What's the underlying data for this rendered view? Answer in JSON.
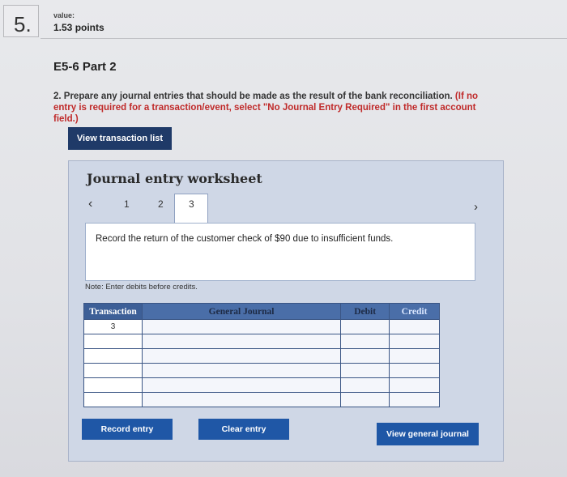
{
  "question": {
    "number": "5.",
    "value_label": "value:",
    "points": "1.53 points"
  },
  "part_title": "E5-6 Part 2",
  "instructions": {
    "main": "2. Prepare any journal entries that should be made as the result of the bank reconciliation.",
    "note_red": "(If no entry is required for a transaction/event, select \"No Journal Entry Required\" in the first account field.)"
  },
  "view_transaction_button": "View transaction list",
  "worksheet": {
    "title": "Journal entry worksheet",
    "nav": {
      "prev_icon": "chevron-left-icon",
      "next_icon": "chevron-right-icon",
      "tabs": [
        "1",
        "2",
        "3"
      ],
      "active_tab": "3"
    },
    "prompt": "Record the return of the customer check of $90 due to insufficient funds.",
    "note": "Note: Enter debits before credits.",
    "table": {
      "headers": [
        "Transaction",
        "General Journal",
        "Debit",
        "Credit"
      ],
      "rows": [
        {
          "transaction": "3",
          "account": "",
          "debit": "",
          "credit": ""
        },
        {
          "transaction": "",
          "account": "",
          "debit": "",
          "credit": ""
        },
        {
          "transaction": "",
          "account": "",
          "debit": "",
          "credit": ""
        },
        {
          "transaction": "",
          "account": "",
          "debit": "",
          "credit": ""
        },
        {
          "transaction": "",
          "account": "",
          "debit": "",
          "credit": ""
        },
        {
          "transaction": "",
          "account": "",
          "debit": "",
          "credit": ""
        }
      ]
    },
    "buttons": {
      "record": "Record entry",
      "clear": "Clear entry",
      "view_general_journal": "View general journal"
    }
  },
  "colors": {
    "primary_button": "#1f57a6",
    "dark_button": "#1f3a68",
    "header_blue": "#4a6ea8",
    "red_text": "#c02a2a"
  }
}
